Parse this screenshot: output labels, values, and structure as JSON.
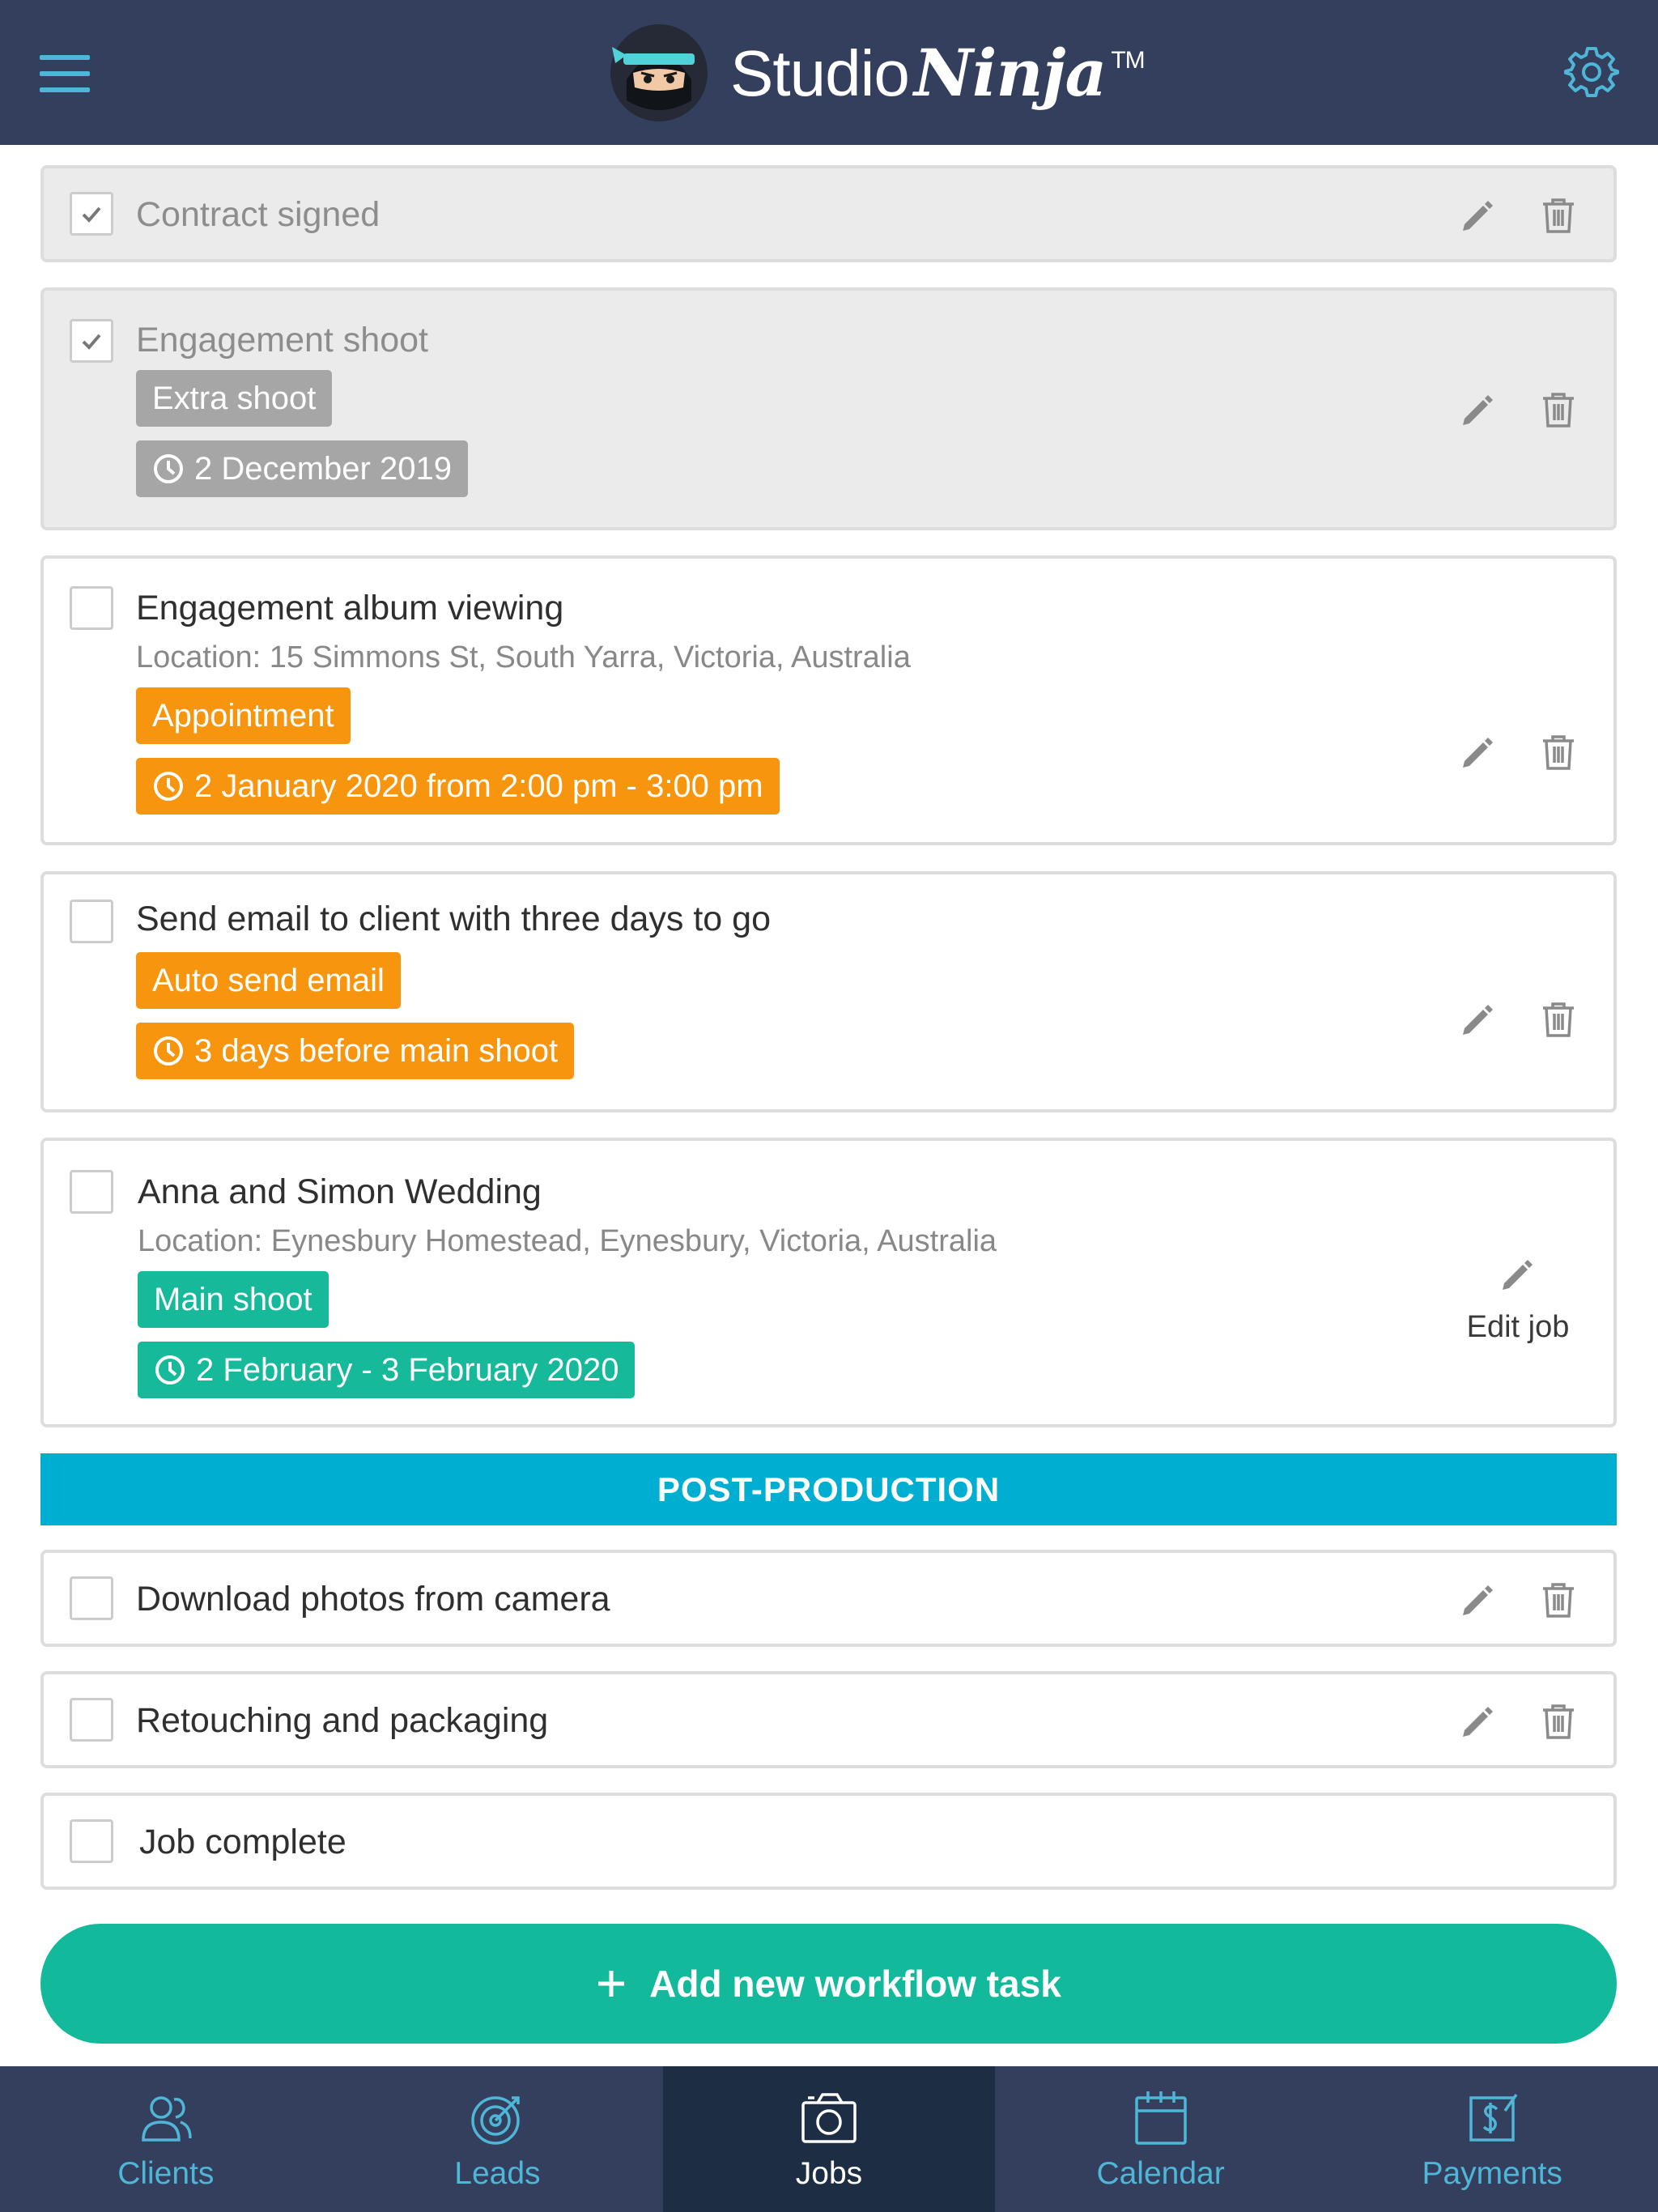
{
  "header": {
    "logo_studio": "Studio",
    "logo_ninja": "Ninja",
    "logo_tm": "TM",
    "menu_icon": "hamburger-menu-icon",
    "settings_icon": "gear-icon"
  },
  "tasks": [
    {
      "title": "Contract signed",
      "completed": true
    },
    {
      "title": "Engagement shoot",
      "completed": true,
      "tag": "Extra shoot",
      "date": "2 December 2019"
    },
    {
      "title": "Engagement album viewing",
      "completed": false,
      "location": "Location: 15 Simmons St, South Yarra, Victoria, Australia",
      "tag": "Appointment",
      "date": "2 January 2020 from 2:00 pm - 3:00 pm"
    },
    {
      "title": "Send email to client with three days to go",
      "completed": false,
      "tag": "Auto send email",
      "date": "3 days before main shoot"
    },
    {
      "title": "Anna and Simon Wedding",
      "completed": false,
      "location": "Location: Eynesbury Homestead, Eynesbury, Victoria, Australia",
      "tag": "Main shoot",
      "date": "2 February - 3 February 2020",
      "edit_label": "Edit job"
    }
  ],
  "section": {
    "title": "POST-PRODUCTION"
  },
  "post_tasks": [
    {
      "title": "Download photos from camera",
      "completed": false
    },
    {
      "title": "Retouching and packaging",
      "completed": false
    },
    {
      "title": "Job complete",
      "completed": false
    }
  ],
  "add_button": {
    "label": "Add new workflow task"
  },
  "nav": {
    "active": "Jobs",
    "items": [
      {
        "label": "Clients",
        "icon": "users-icon"
      },
      {
        "label": "Leads",
        "icon": "target-icon"
      },
      {
        "label": "Jobs",
        "icon": "camera-icon"
      },
      {
        "label": "Calendar",
        "icon": "calendar-icon"
      },
      {
        "label": "Payments",
        "icon": "payment-icon"
      }
    ]
  },
  "colors": {
    "header_bg": "#333f5c",
    "accent_blue": "#4fb6d8",
    "section_bg": "#00aed1",
    "tag_gray": "#a6a6a6",
    "tag_orange": "#f7950f",
    "tag_green": "#17b99b",
    "add_button_bg": "#12b99b",
    "nav_active_bg": "#1c2d44"
  }
}
